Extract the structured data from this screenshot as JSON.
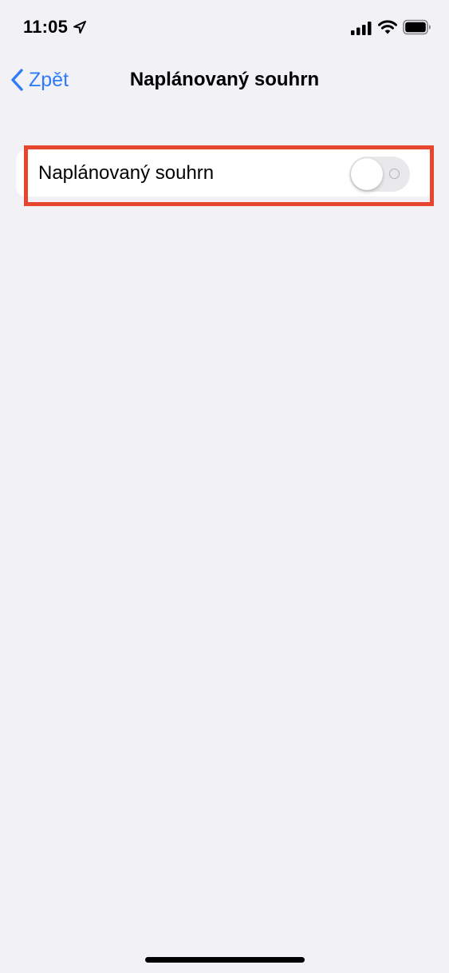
{
  "status_bar": {
    "time": "11:05",
    "location_icon": "location-arrow-icon",
    "signal_icon": "cellular-signal-icon",
    "wifi_icon": "wifi-icon",
    "battery_icon": "battery-icon"
  },
  "nav": {
    "back_label": "Zpět",
    "back_icon": "chevron-left-icon",
    "title": "Naplánovaný souhrn"
  },
  "settings": {
    "rows": [
      {
        "label": "Naplánovaný souhrn",
        "toggle_on": false
      }
    ]
  },
  "colors": {
    "accent": "#2f7cf6",
    "background": "#f2f1f6",
    "highlight": "#e8452f",
    "toggle_off_track": "#e9e9eb"
  }
}
